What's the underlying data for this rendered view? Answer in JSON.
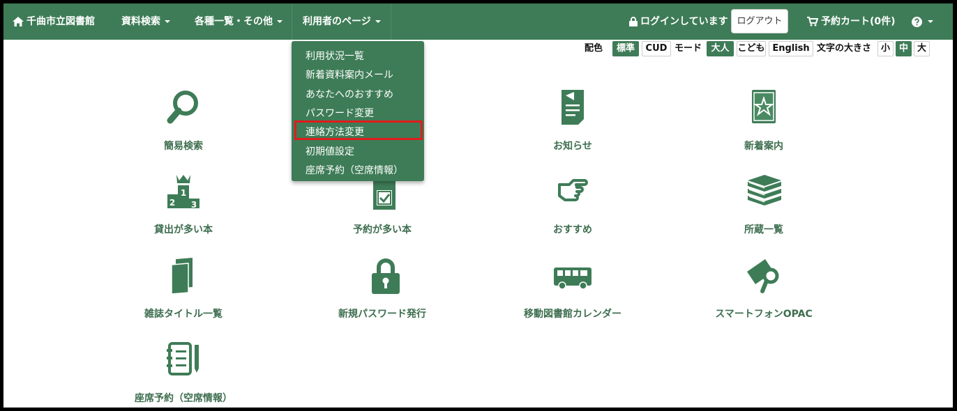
{
  "colors": {
    "brand": "#3e7c57",
    "highlight": "#e21b1b",
    "tile_text": "#3e6e4f"
  },
  "navbar": {
    "home": {
      "icon": "home-icon",
      "label": "千曲市立図書館"
    },
    "menus": [
      {
        "label": "資料検索"
      },
      {
        "label": "各種一覧・その他"
      },
      {
        "label": "利用者のページ"
      }
    ],
    "login_status": {
      "icon": "lock-icon",
      "label": "ログインしています"
    },
    "logout_label": "ログアウト",
    "cart": {
      "icon": "cart-icon",
      "label": "予約カート(0件)"
    },
    "help": {
      "icon": "question-circle-icon"
    }
  },
  "dropdown": {
    "items": [
      "利用状況一覧",
      "新着資料案内メール",
      "あなたへのおすすめ",
      "パスワード変更",
      "連絡方法変更",
      "初期値設定",
      "座席予約（空席情報）"
    ],
    "highlighted_index": 4
  },
  "options": {
    "color_label": "配色",
    "color_options": [
      "標準",
      "CUD"
    ],
    "color_selected": "標準",
    "mode_label": "モード",
    "mode_options": [
      "大人",
      "こども",
      "English"
    ],
    "mode_selected": "大人",
    "size_label": "文字の大きさ",
    "size_options": [
      "小",
      "中",
      "大"
    ],
    "size_selected": "中"
  },
  "tiles": [
    {
      "label": "簡易検索",
      "icon": "magnifier-icon"
    },
    {
      "label": "お知らせ",
      "icon": "notice-document-icon"
    },
    {
      "label": "新着案内",
      "icon": "star-book-icon"
    },
    {
      "label": "貸出が多い本",
      "icon": "ranking-podium-icon"
    },
    {
      "label": "予約が多い本",
      "icon": "checkbox-book-icon"
    },
    {
      "label": "おすすめ",
      "icon": "pointing-hand-icon"
    },
    {
      "label": "所蔵一覧",
      "icon": "book-stack-icon"
    },
    {
      "label": "雑誌タイトル一覧",
      "icon": "magazine-icon"
    },
    {
      "label": "新規パスワード発行",
      "icon": "padlock-icon"
    },
    {
      "label": "移動図書館カレンダー",
      "icon": "bus-icon"
    },
    {
      "label": "スマートフォンOPAC",
      "icon": "smartphone-search-icon"
    },
    {
      "label": "座席予約（空席情報）",
      "icon": "notebook-pen-icon"
    }
  ]
}
